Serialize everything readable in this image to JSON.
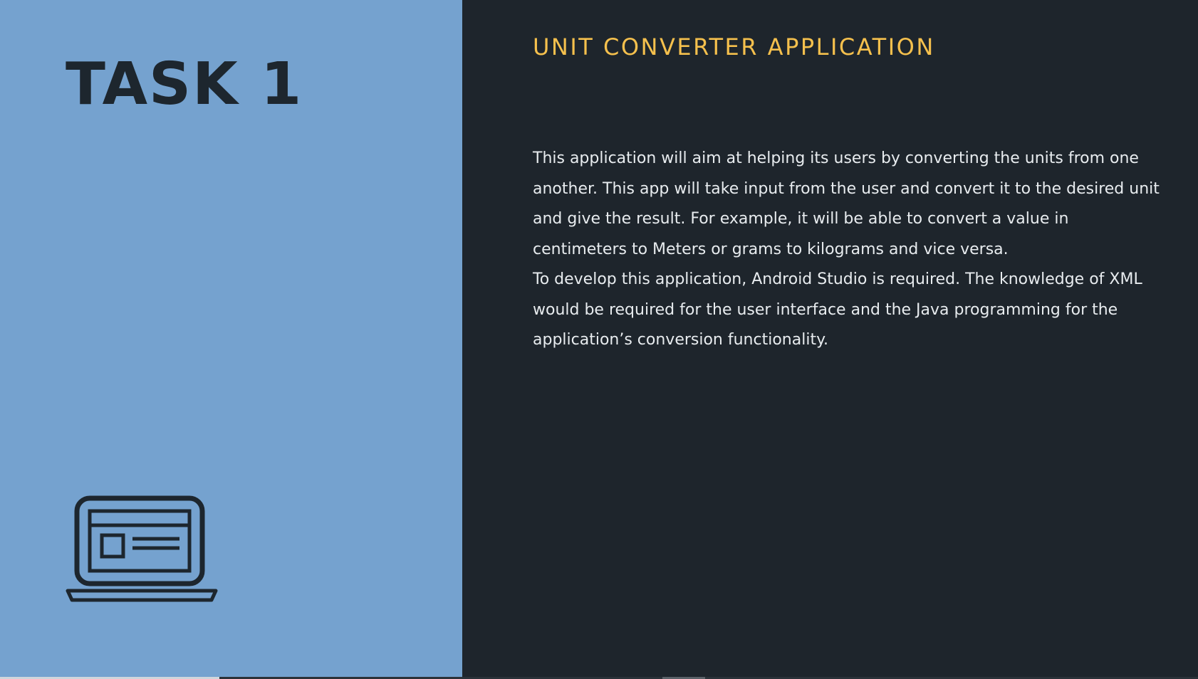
{
  "left_panel": {
    "title": "TASK 1",
    "icon": "laptop-icon",
    "background": "#75a2cf"
  },
  "right_panel": {
    "heading": "UNIT CONVERTER APPLICATION",
    "heading_color": "#f5c04d",
    "paragraphs": [
      "This application will aim at helping its users by converting the units from one another. This app will take input from the user and convert it to the desired unit and give the result. For example, it will be able to convert a value in centimeters to Meters or grams to kilograms and vice versa.",
      "To develop this application, Android Studio is required. The knowledge of XML would be required for the user interface and the Java programming for the application’s conversion functionality."
    ],
    "background": "#1e252c"
  }
}
